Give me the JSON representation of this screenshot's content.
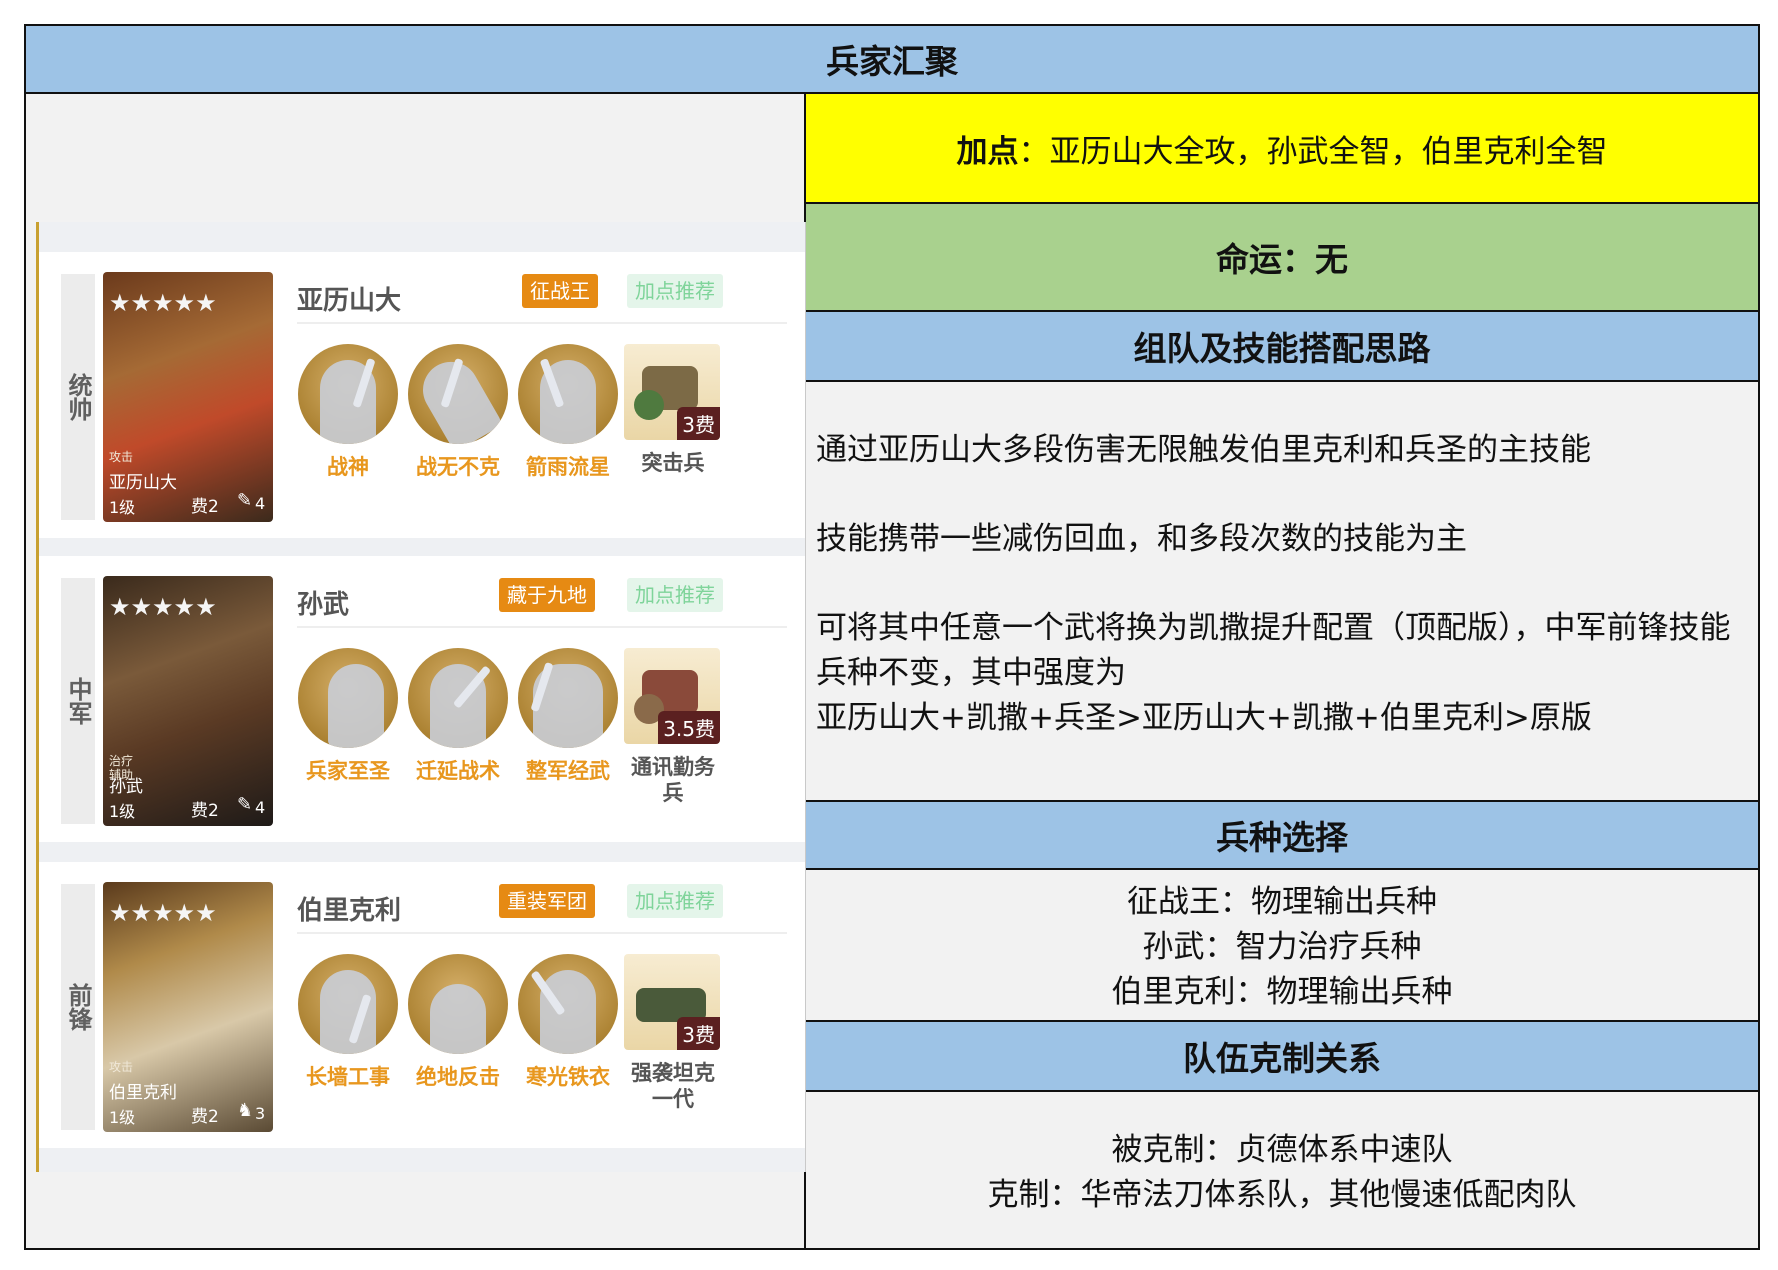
{
  "title": "兵家汇聚",
  "dianshu": {
    "label": "加点",
    "sep": "：",
    "text": "亚历山大全攻，孙武全智，伯里克利全智"
  },
  "fate": "命运：无",
  "sections": {
    "team": {
      "header": "组队及技能搭配思路",
      "p1": "通过亚历山大多段伤害无限触发伯里克利和兵圣的主技能",
      "p2": "技能携带一些减伤回血，和多段次数的技能为主",
      "p3": "可将其中任意一个武将换为凯撒提升配置（顶配版），中军前锋技能兵种不变，其中强度为",
      "p4": "亚历山大+凯撒+兵圣>亚历山大+凯撒+伯里克利>原版"
    },
    "troops": {
      "header": "兵种选择",
      "lines": [
        "征战王：物理输出兵种",
        "孙武：智力治疗兵种",
        "伯里克利：物理输出兵种"
      ]
    },
    "counter": {
      "header": "队伍克制关系",
      "lines": [
        "被克制：贞德体系中速队",
        "克制：华帝法刀体系队，其他慢速低配肉队"
      ]
    }
  },
  "generals": [
    {
      "position": "统帅",
      "name": "亚历山大",
      "role": "攻击",
      "level": "1级",
      "fee": "费2",
      "quill": "4",
      "stars": "★★★★★",
      "tag": "征战王",
      "rec": "加点推荐",
      "skills": [
        "战神",
        "战无不克",
        "箭雨流星"
      ],
      "troop": {
        "name": "突击兵",
        "cost": "3费"
      }
    },
    {
      "position": "中军",
      "name": "孙武",
      "role": "治疗 辅助",
      "level": "1级",
      "fee": "费2",
      "quill": "4",
      "stars": "★★★★★",
      "tag": "藏于九地",
      "rec": "加点推荐",
      "skills": [
        "兵家至圣",
        "迁延战术",
        "整军经武"
      ],
      "troop": {
        "name": "通讯勤务兵",
        "cost": "3.5费"
      }
    },
    {
      "position": "前锋",
      "name": "伯里克利",
      "role": "攻击",
      "level": "1级",
      "fee": "费2",
      "quill": "3",
      "stars": "★★★★★",
      "tag": "重装军团",
      "rec": "加点推荐",
      "skills": [
        "长墙工事",
        "绝地反击",
        "寒光铁衣"
      ],
      "troop": {
        "name": "强袭坦克一代",
        "cost": "3费"
      }
    }
  ],
  "colors": {
    "title_bg": "#9dc3e6",
    "yellow": "#ffff00",
    "green": "#a9d18e",
    "panel_bg": "#f2f2f2",
    "tag_orange": "#e68a13",
    "skill_text": "#e8971e"
  }
}
